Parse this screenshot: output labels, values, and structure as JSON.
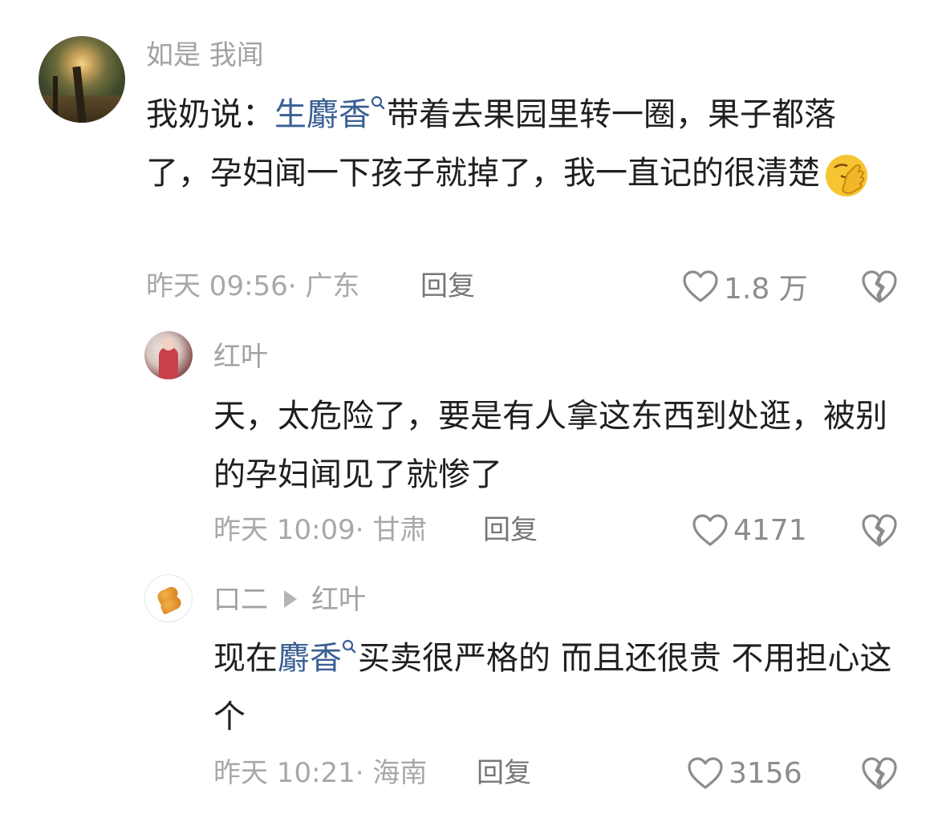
{
  "comments": [
    {
      "username": "如是 我闻",
      "text_before": "我奶说：",
      "link": "生麝香",
      "text_after": "带着去果园里转一圈，果子都落了，孕妇闻一下孩子就掉了，我一直记的很清楚",
      "emoji": "facepalm-emoji",
      "meta": "昨天 09:56· 广东",
      "reply_label": "回复",
      "likes": "1.8 万"
    }
  ],
  "replies": [
    {
      "username": "红叶",
      "text": "天，太危险了，要是有人拿这东西到处逛，被别的孕妇闻见了就惨了",
      "meta": "昨天 10:09· 甘肃",
      "reply_label": "回复",
      "likes": "4171"
    },
    {
      "username": "口二",
      "reply_to": "红叶",
      "text_before": "现在",
      "link": "麝香",
      "text_after": "买卖很严格的 而且还很贵 不用担心这个",
      "meta": "昨天 10:21· 海南",
      "reply_label": "回复",
      "likes": "3156"
    }
  ],
  "icons": {
    "like": "heart-outline-icon",
    "dislike": "broken-heart-icon",
    "search": "search-icon"
  },
  "colors": {
    "link": "#3a5f93",
    "meta": "#a8a8a8",
    "text": "#1f1f1f"
  }
}
